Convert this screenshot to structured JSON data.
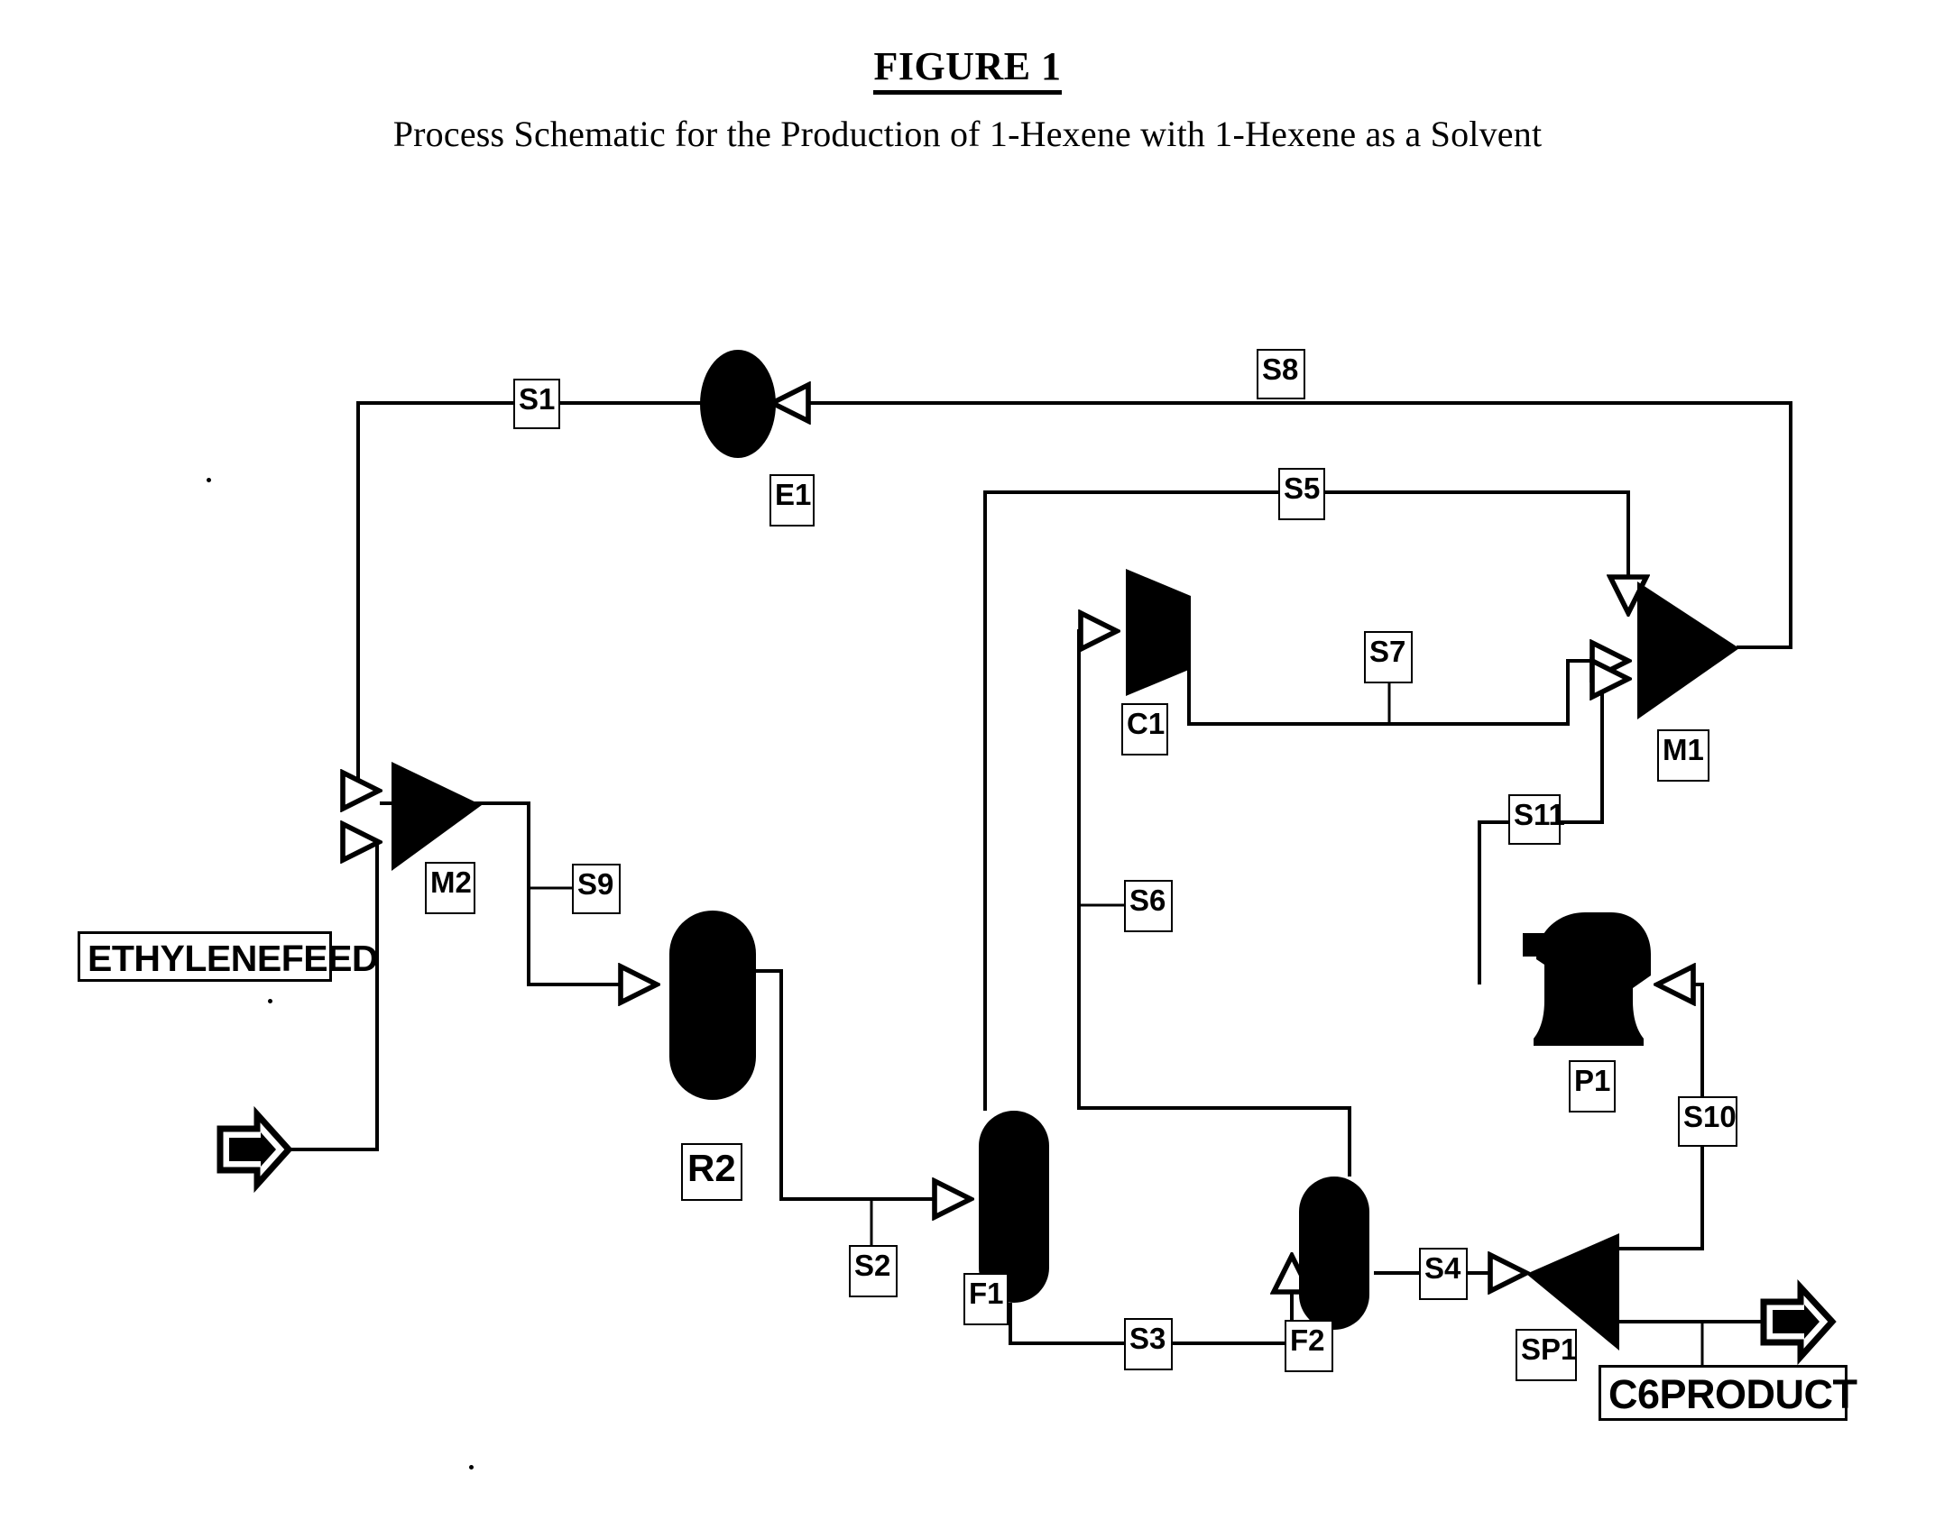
{
  "figure": {
    "title": "FIGURE 1",
    "subtitle": "Process Schematic for the Production of 1-Hexene with 1-Hexene as a Solvent"
  },
  "diagram": {
    "type": "process-flow-diagram",
    "feeds": [
      {
        "id": "ETHYLENEFEED",
        "label": "ETHYLENEFEED"
      }
    ],
    "products": [
      {
        "id": "C6PRODUCT",
        "label": "C6PRODUCT"
      }
    ],
    "units": [
      {
        "id": "E1",
        "label": "E1",
        "kind": "heat-exchanger",
        "shape": "filled-ellipse"
      },
      {
        "id": "M1",
        "label": "M1",
        "kind": "mixer",
        "shape": "filled-triangle-right",
        "inlets": 3
      },
      {
        "id": "M2",
        "label": "M2",
        "kind": "mixer",
        "shape": "filled-triangle-right",
        "inlets": 2
      },
      {
        "id": "C1",
        "label": "C1",
        "kind": "compressor",
        "shape": "filled-trapezoid"
      },
      {
        "id": "R2",
        "label": "R2",
        "kind": "reactor",
        "shape": "filled-capsule"
      },
      {
        "id": "F1",
        "label": "F1",
        "kind": "flash-vessel",
        "shape": "filled-capsule"
      },
      {
        "id": "F2",
        "label": "F2",
        "kind": "flash-vessel",
        "shape": "filled-capsule"
      },
      {
        "id": "P1",
        "label": "P1",
        "kind": "pump",
        "shape": "filled-pump"
      },
      {
        "id": "SP1",
        "label": "SP1",
        "kind": "splitter",
        "shape": "filled-triangle-left"
      }
    ],
    "streams": [
      {
        "id": "S1",
        "label": "S1",
        "from": "E1",
        "to": "M2"
      },
      {
        "id": "S2",
        "label": "S2",
        "from": "R2",
        "to": "F1"
      },
      {
        "id": "S3",
        "label": "S3",
        "from": "F1",
        "to": "F2"
      },
      {
        "id": "S4",
        "label": "S4",
        "from": "F2",
        "to": "SP1"
      },
      {
        "id": "S5",
        "label": "S5",
        "from": "F1",
        "to": "M1"
      },
      {
        "id": "S6",
        "label": "S6",
        "from": "F2",
        "to": "C1"
      },
      {
        "id": "S7",
        "label": "S7",
        "from": "C1",
        "to": "M1"
      },
      {
        "id": "S8",
        "label": "S8",
        "from": "M1",
        "to": "E1"
      },
      {
        "id": "S9",
        "label": "S9",
        "from": "M2",
        "to": "R2"
      },
      {
        "id": "S10",
        "label": "S10",
        "from": "SP1",
        "to": "P1"
      },
      {
        "id": "S11",
        "label": "S11",
        "from": "P1",
        "to": "M1"
      }
    ],
    "colors": {
      "line": "#000000",
      "fill": "#000000",
      "background": "#ffffff"
    }
  }
}
